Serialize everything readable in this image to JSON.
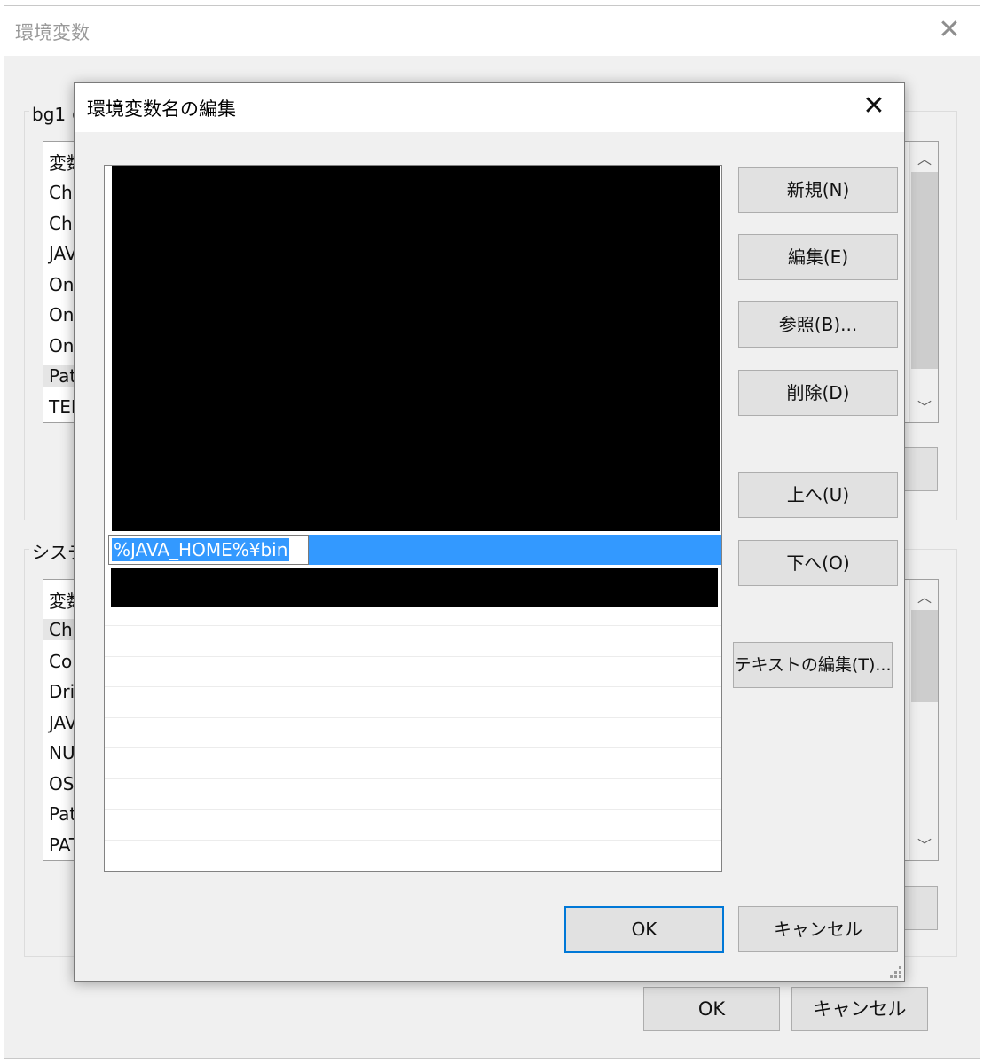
{
  "back_window": {
    "title": "環境変数",
    "user_section_label": "bg1 の",
    "user_vars": [
      "変数",
      "Ch",
      "Ch",
      "JAV",
      "On",
      "On",
      "On",
      "Pat",
      "TEI"
    ],
    "system_section_label": "システ",
    "system_vars": [
      "変数",
      "Ch",
      "Co",
      "Dri",
      "JAV",
      "NU",
      "OS",
      "Pat",
      "PAT"
    ],
    "ok_label": "OK",
    "cancel_label": "キャンセル"
  },
  "dialog": {
    "title": "環境変数名の編集",
    "editing_value": "%JAVA_HOME%¥bin",
    "buttons": {
      "new": "新規(N)",
      "edit": "編集(E)",
      "browse": "参照(B)...",
      "delete": "削除(D)",
      "up": "上へ(U)",
      "down": "下へ(O)",
      "edit_text": "テキストの編集(T)..."
    },
    "ok_label": "OK",
    "cancel_label": "キャンセル"
  },
  "icons": {
    "close": "close-icon",
    "scroll_up": "chevron-up-icon",
    "scroll_down": "chevron-down-icon",
    "resize": "resize-grip-icon"
  },
  "colors": {
    "selection": "#3399ff",
    "default_button_border": "#0078d7",
    "button_face": "#e1e1e1"
  }
}
